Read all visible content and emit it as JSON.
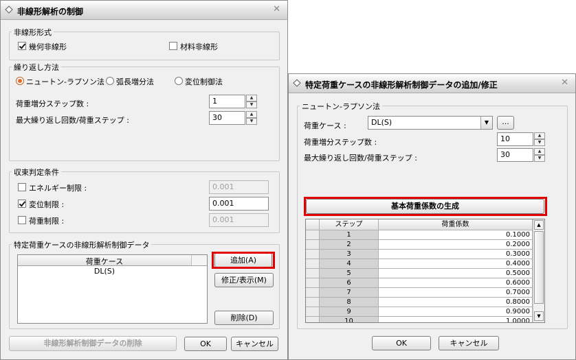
{
  "left_dialog": {
    "title": "非線形解析の制御",
    "close_label": "✕",
    "nonlinear_type": {
      "label": "非線形形式",
      "geometric": {
        "label": "幾何非線形",
        "checked": true
      },
      "material": {
        "label": "材料非線形",
        "checked": false
      }
    },
    "iteration": {
      "label": "繰り返し方法",
      "methods": [
        {
          "label": "ニュートン-ラプソン法",
          "selected": true
        },
        {
          "label": "弧長増分法",
          "selected": false
        },
        {
          "label": "変位制御法",
          "selected": false
        }
      ],
      "load_steps_label": "荷重増分ステップ数 :",
      "load_steps_value": "1",
      "max_iter_label": "最大繰り返し回数/荷重ステップ :",
      "max_iter_value": "30"
    },
    "convergence": {
      "label": "収束判定条件",
      "energy": {
        "label": "エネルギー制限 :",
        "checked": false,
        "value": "0.001"
      },
      "displacement": {
        "label": "変位制限 :",
        "checked": true,
        "value": "0.001"
      },
      "load": {
        "label": "荷重制限 :",
        "checked": false,
        "value": "0.001"
      }
    },
    "specific": {
      "label": "特定荷重ケースの非線形解析制御データ",
      "list_header": "荷重ケース",
      "items": [
        "DL(S)"
      ],
      "add_label": "追加(A)",
      "modify_label": "修正/表示(M)",
      "delete_label": "削除(D)"
    },
    "delete_all_label": "非線形解析制御データの削除",
    "ok_label": "OK",
    "cancel_label": "キャンセル"
  },
  "right_dialog": {
    "title": "特定荷重ケースの非線形解析制御データの追加/修正",
    "close_label": "✕",
    "group_label": "ニュートン-ラプソン法",
    "load_case_label": "荷重ケース :",
    "load_case_value": "DL(S)",
    "browse_label": "...",
    "load_steps_label": "荷重増分ステップ数 :",
    "load_steps_value": "10",
    "max_iter_label": "最大繰り返し回数/荷重ステップ :",
    "max_iter_value": "30",
    "generate_label": "基本荷重係数の生成",
    "table": {
      "headers": [
        "ステップ",
        "荷重係数"
      ],
      "rows": [
        [
          "1",
          "0.1000"
        ],
        [
          "2",
          "0.2000"
        ],
        [
          "3",
          "0.3000"
        ],
        [
          "4",
          "0.4000"
        ],
        [
          "5",
          "0.5000"
        ],
        [
          "6",
          "0.6000"
        ],
        [
          "7",
          "0.7000"
        ],
        [
          "8",
          "0.8000"
        ],
        [
          "9",
          "0.9000"
        ],
        [
          "10",
          "1.0000"
        ]
      ]
    },
    "ok_label": "OK",
    "cancel_label": "キャンセル"
  }
}
